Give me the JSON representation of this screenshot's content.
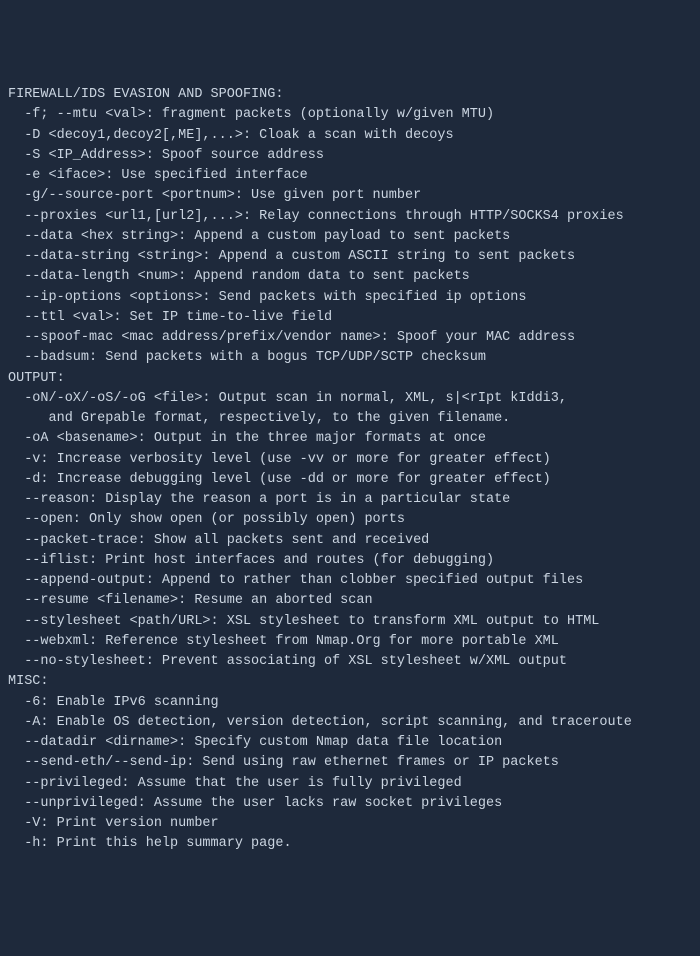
{
  "sections": [
    {
      "header": "FIREWALL/IDS EVASION AND SPOOFING:",
      "lines": [
        "  -f; --mtu <val>: fragment packets (optionally w/given MTU)",
        "  -D <decoy1,decoy2[,ME],...>: Cloak a scan with decoys",
        "  -S <IP_Address>: Spoof source address",
        "  -e <iface>: Use specified interface",
        "  -g/--source-port <portnum>: Use given port number",
        "  --proxies <url1,[url2],...>: Relay connections through HTTP/SOCKS4 proxies",
        "  --data <hex string>: Append a custom payload to sent packets",
        "  --data-string <string>: Append a custom ASCII string to sent packets",
        "  --data-length <num>: Append random data to sent packets",
        "  --ip-options <options>: Send packets with specified ip options",
        "  --ttl <val>: Set IP time-to-live field",
        "  --spoof-mac <mac address/prefix/vendor name>: Spoof your MAC address",
        "  --badsum: Send packets with a bogus TCP/UDP/SCTP checksum"
      ]
    },
    {
      "header": "OUTPUT:",
      "lines": [
        "  -oN/-oX/-oS/-oG <file>: Output scan in normal, XML, s|<rIpt kIddi3,",
        "     and Grepable format, respectively, to the given filename.",
        "  -oA <basename>: Output in the three major formats at once",
        "  -v: Increase verbosity level (use -vv or more for greater effect)",
        "  -d: Increase debugging level (use -dd or more for greater effect)",
        "  --reason: Display the reason a port is in a particular state",
        "  --open: Only show open (or possibly open) ports",
        "  --packet-trace: Show all packets sent and received",
        "  --iflist: Print host interfaces and routes (for debugging)",
        "  --append-output: Append to rather than clobber specified output files",
        "  --resume <filename>: Resume an aborted scan",
        "  --stylesheet <path/URL>: XSL stylesheet to transform XML output to HTML",
        "  --webxml: Reference stylesheet from Nmap.Org for more portable XML",
        "  --no-stylesheet: Prevent associating of XSL stylesheet w/XML output"
      ]
    },
    {
      "header": "MISC:",
      "lines": [
        "  -6: Enable IPv6 scanning",
        "  -A: Enable OS detection, version detection, script scanning, and traceroute",
        "  --datadir <dirname>: Specify custom Nmap data file location",
        "  --send-eth/--send-ip: Send using raw ethernet frames or IP packets",
        "  --privileged: Assume that the user is fully privileged",
        "  --unprivileged: Assume the user lacks raw socket privileges",
        "  -V: Print version number",
        "  -h: Print this help summary page."
      ]
    }
  ]
}
